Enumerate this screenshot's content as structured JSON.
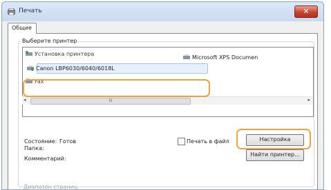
{
  "window": {
    "title": "Печать"
  },
  "tabs": [
    {
      "label": "Общие"
    }
  ],
  "printer_group": {
    "label": "Выберите принтер"
  },
  "printers": [
    {
      "label": "Установка принтера",
      "icon": "printer-add-icon"
    },
    {
      "label": "Microsoft XPS Documen",
      "icon": "printer-icon"
    },
    {
      "label": "Canon LBP6030/6040/6018L",
      "icon": "printer-icon",
      "selected": true
    },
    {
      "label": "Fax",
      "icon": "fax-icon"
    }
  ],
  "scrollbar": {
    "left_arrow": "◂",
    "right_arrow": "▸",
    "thumb_grip": "III"
  },
  "status": {
    "label": "Состояние:",
    "value": "Готов"
  },
  "folder": {
    "label": "Папка:"
  },
  "comment": {
    "label": "Комментарий:"
  },
  "print_to_file": {
    "label": "Печать в файл",
    "checked": false
  },
  "buttons": {
    "setup": "Настройка",
    "find_printer": "Найти принтер..."
  },
  "faded_section": {
    "label": "Диапазон страниц"
  },
  "close_glyph": "✕",
  "colors": {
    "highlight": "#f0a23a",
    "close_button": "#c8432d",
    "selection": "#e6f1fc"
  }
}
